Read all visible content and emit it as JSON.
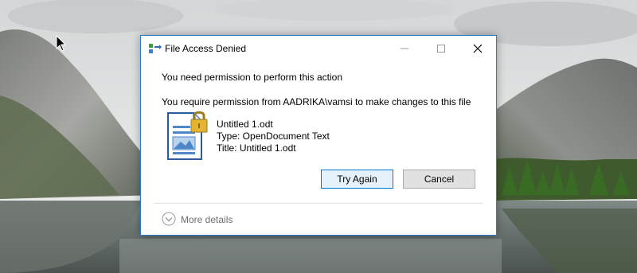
{
  "dialog": {
    "title": "File Access Denied",
    "heading": "You need permission to perform this action",
    "message": "You require permission from AADRIKA\\vamsi to make changes to this file",
    "file": {
      "name": "Untitled 1.odt",
      "type": "Type: OpenDocument Text",
      "title": "Title: Untitled 1.odt"
    },
    "buttons": {
      "try_again": "Try Again",
      "cancel": "Cancel"
    },
    "more_details": "More details"
  },
  "colors": {
    "accent": "#0078d7",
    "dialog_border": "#2b79c7",
    "cancel_button": "#e1e1e1"
  },
  "icons": {
    "app": "file-transfer-icon",
    "file": "locked-document-icon",
    "details": "chevron-down-icon"
  }
}
